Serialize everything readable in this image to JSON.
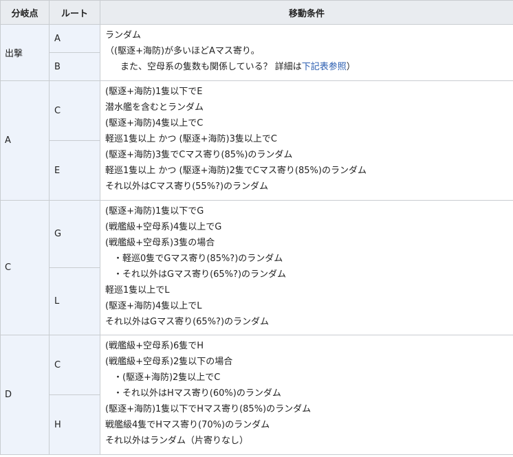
{
  "headers": {
    "branch": "分岐点",
    "route": "ルート",
    "condition": "移動条件"
  },
  "groups": [
    {
      "branch": "出撃",
      "routes": [
        "A",
        "B"
      ],
      "conditions": [
        "ランダム",
        "（(駆逐+海防)が多いほどAマス寄り。",
        "また、空母系の隻数も関係している？ 詳細は",
        "下記表参照",
        "）"
      ]
    },
    {
      "branch": "A",
      "routes": [
        "C",
        "E"
      ],
      "conditions": [
        "(駆逐+海防)1隻以下でE",
        "潜水艦を含むとランダム",
        "(駆逐+海防)4隻以上でC",
        "軽巡1隻以上 かつ (駆逐+海防)3隻以上でC",
        "(駆逐+海防)3隻でCマス寄り(85%)のランダム",
        "軽巡1隻以上 かつ (駆逐+海防)2隻でCマス寄り(85%)のランダム",
        "それ以外はCマス寄り(55%?)のランダム"
      ]
    },
    {
      "branch": "C",
      "routes": [
        "G",
        "L"
      ],
      "conditions": [
        "(駆逐+海防)1隻以下でG",
        "(戦艦級+空母系)4隻以上でG",
        "(戦艦級+空母系)3隻の場合",
        "・軽巡0隻でGマス寄り(85%?)のランダム",
        "・それ以外はGマス寄り(65%?)のランダム",
        "軽巡1隻以上でL",
        "(駆逐+海防)4隻以上でL",
        "それ以外はGマス寄り(65%?)のランダム"
      ]
    },
    {
      "branch": "D",
      "routes": [
        "C",
        "H"
      ],
      "conditions": [
        "(戦艦級+空母系)6隻でH",
        "(戦艦級+空母系)2隻以下の場合",
        "・(駆逐+海防)2隻以上でC",
        "・それ以外はHマス寄り(60%)のランダム",
        "(駆逐+海防)1隻以下でHマス寄り(85%)のランダム",
        "戦艦級4隻でHマス寄り(70%)のランダム",
        "それ以外はランダム（片寄りなし）"
      ]
    }
  ]
}
